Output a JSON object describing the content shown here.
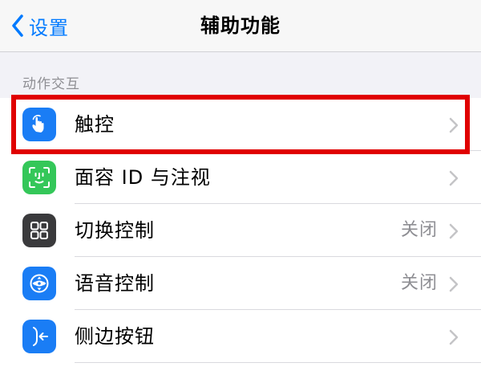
{
  "nav": {
    "back_label": "设置",
    "title": "辅助功能",
    "back_icon": "chevron-left-icon"
  },
  "section": {
    "header": "动作交互"
  },
  "rows": [
    {
      "label": "触控",
      "value": "",
      "icon": "touch-hand-icon",
      "icon_color": "#1a7df5",
      "highlighted": true
    },
    {
      "label": "面容 ID 与注视",
      "value": "",
      "icon": "face-id-icon",
      "icon_color": "#34c759",
      "highlighted": false
    },
    {
      "label": "切换控制",
      "value": "关闭",
      "icon": "switch-control-grid-icon",
      "icon_color": "#3a3a3c",
      "highlighted": false
    },
    {
      "label": "语音控制",
      "value": "关闭",
      "icon": "voice-control-icon",
      "icon_color": "#1a7df5",
      "highlighted": false
    },
    {
      "label": "侧边按钮",
      "value": "",
      "icon": "side-button-icon",
      "icon_color": "#1a7df5",
      "highlighted": false
    }
  ],
  "colors": {
    "accent": "#007aff",
    "highlight": "#e00000",
    "secondary_text": "#8e8e93"
  }
}
